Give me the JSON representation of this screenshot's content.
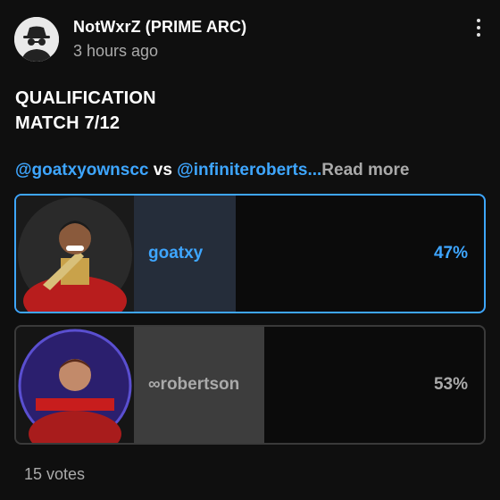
{
  "post": {
    "author": "NotWxrZ (PRIME ARC)",
    "time": "3 hours ago",
    "avatar_icon": "incognito-spy-icon",
    "menu_icon": "more-vertical-icon",
    "title_line1": "QUALIFICATION",
    "title_line2": "MATCH 7/12",
    "mention1": "@goatxyownscc",
    "vs": " vs ",
    "mention2": "@infiniteroberts",
    "ellipsis": "...",
    "read_more": "Read more"
  },
  "poll": {
    "options": [
      {
        "label": "goatxy",
        "percent": "47%",
        "fill_fraction": 0.47,
        "selected": true
      },
      {
        "label": "∞robertson",
        "percent": "53%",
        "fill_fraction": 0.53,
        "selected": false
      }
    ],
    "votes": "15 votes"
  },
  "colors": {
    "background": "#0f0f0f",
    "accent": "#3ea6ff",
    "muted_text": "#aaaaaa",
    "selected_fill": "#252d3a",
    "other_fill": "#3d3d3d"
  }
}
